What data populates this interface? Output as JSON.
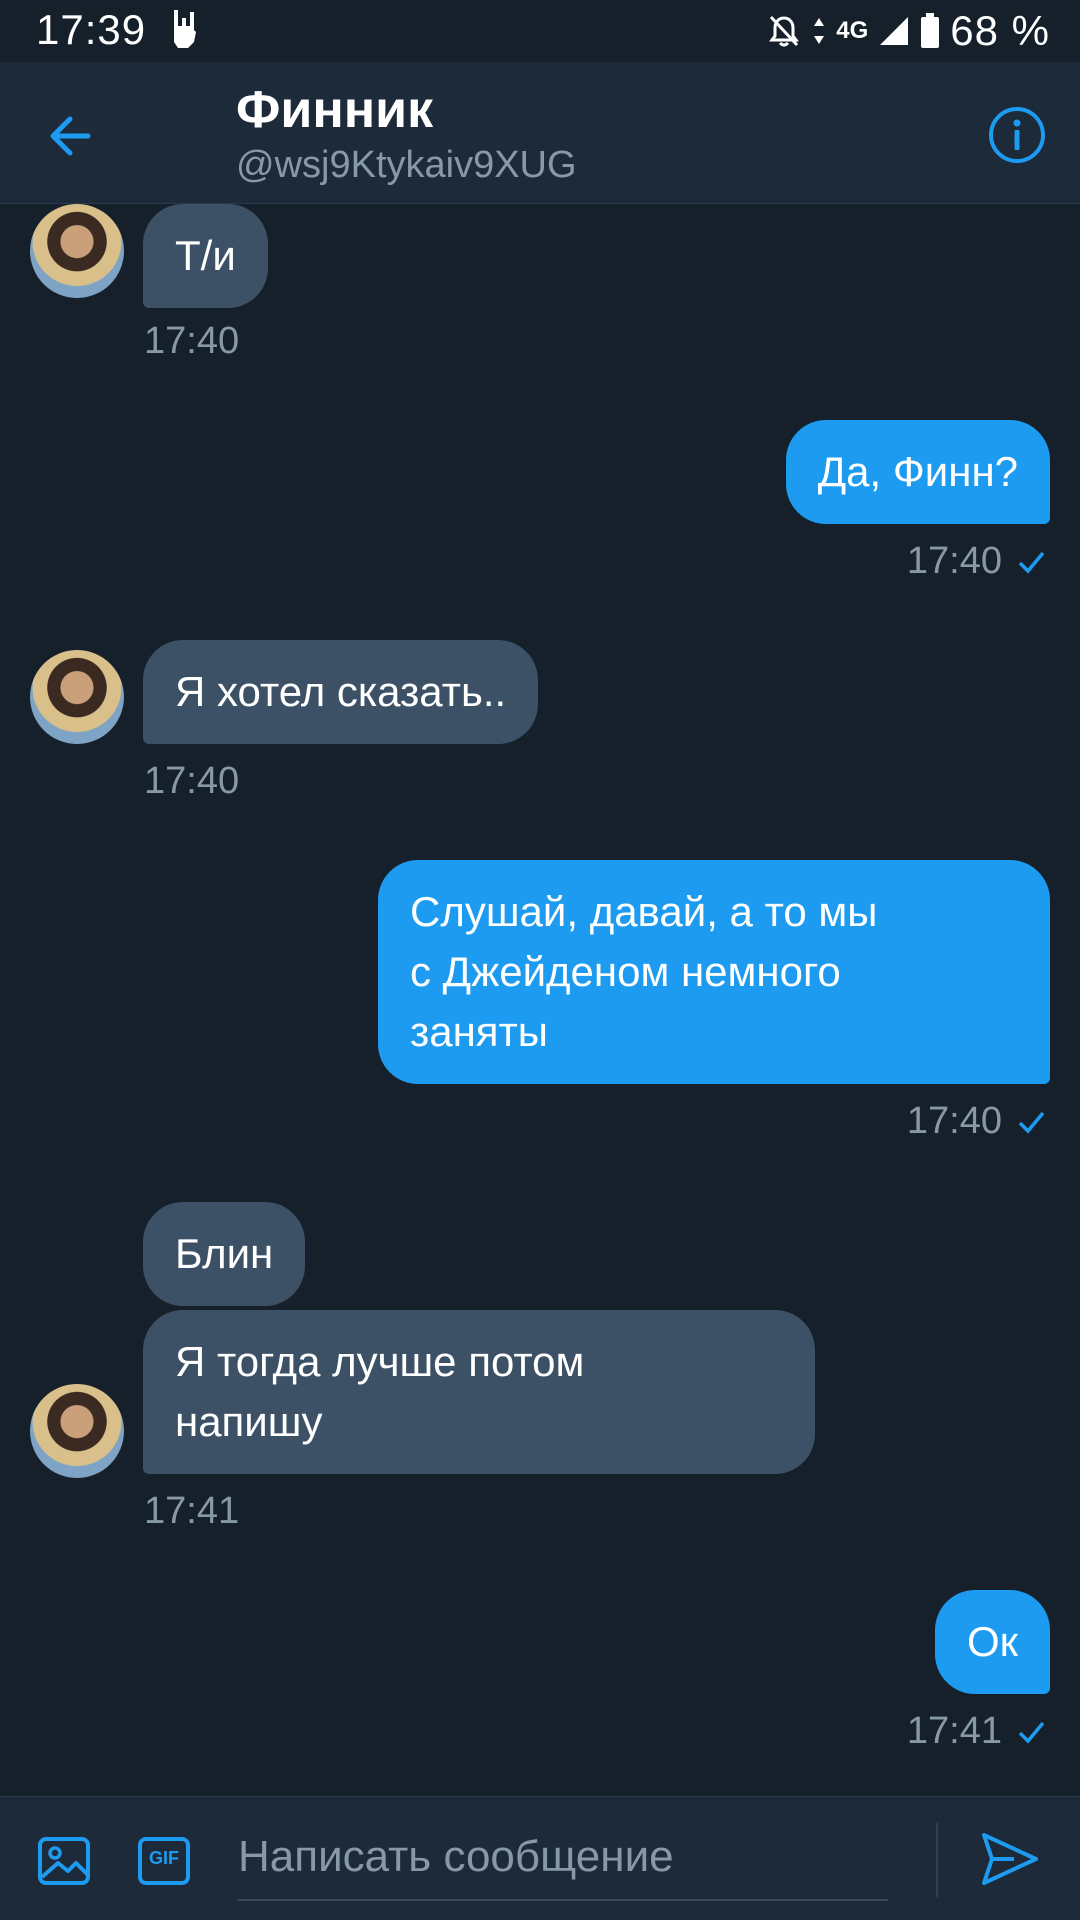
{
  "status_bar": {
    "time": "17:39",
    "network": "4G",
    "battery": "68 %"
  },
  "header": {
    "name": "Финник",
    "handle": "@wsj9Ktykaiv9XUG",
    "back_icon": "arrow-left-icon",
    "info_icon": "info-icon"
  },
  "messages": [
    {
      "side": "in",
      "text": "Т/и",
      "time": "17:40"
    },
    {
      "side": "out",
      "text": "Да, Финн?",
      "time": "17:40"
    },
    {
      "side": "in",
      "text": "Я хотел сказать..",
      "time": "17:40"
    },
    {
      "side": "out",
      "text_lines": [
        "Слушай, давай, а то мы",
        "с Джейденом немного",
        "заняты"
      ],
      "time": "17:40"
    },
    {
      "side": "in",
      "text": "Блин"
    },
    {
      "side": "in",
      "text_lines": [
        "Я тогда лучше потом",
        "напишу"
      ],
      "time": "17:41"
    },
    {
      "side": "out",
      "text": "Ок",
      "time": "17:41"
    }
  ],
  "composer": {
    "placeholder": "Написать сообщение",
    "gif_label": "GIF"
  },
  "colors": {
    "background": "#15202b",
    "accent": "#1d9bf0",
    "incoming_bubble": "#3d5166",
    "muted_text": "#8899a6"
  }
}
